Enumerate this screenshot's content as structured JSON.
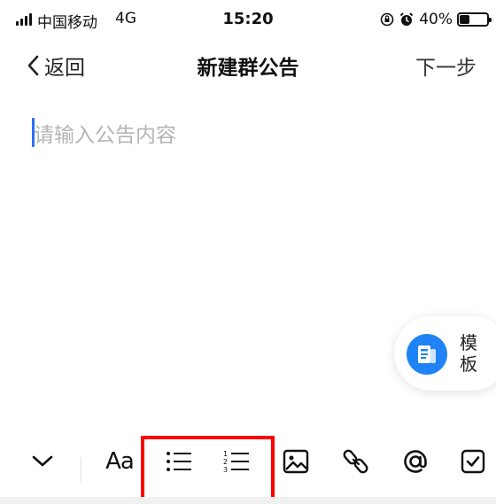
{
  "status_bar": {
    "carrier": "中国移动",
    "network": "4G",
    "time": "15:20",
    "battery": "40%",
    "battery_level": 0.4,
    "icons": [
      "signal-icon",
      "lock-rotation-icon",
      "alarm-icon",
      "battery-icon"
    ]
  },
  "nav": {
    "back_label": "返回",
    "title": "新建群公告",
    "next_label": "下一步"
  },
  "editor": {
    "placeholder": "请输入公告内容"
  },
  "template_button": {
    "label": "模板"
  },
  "toolbar": {
    "items": [
      "collapse-keyboard",
      "text-format",
      "bullet-list",
      "numbered-list",
      "image",
      "link",
      "mention",
      "checkbox"
    ],
    "text_format_label": "Aa"
  },
  "colors": {
    "accent": "#2f6df6",
    "template_blue": "#1f83f5",
    "highlight": "#ff0000",
    "placeholder": "#b5b5b5"
  }
}
